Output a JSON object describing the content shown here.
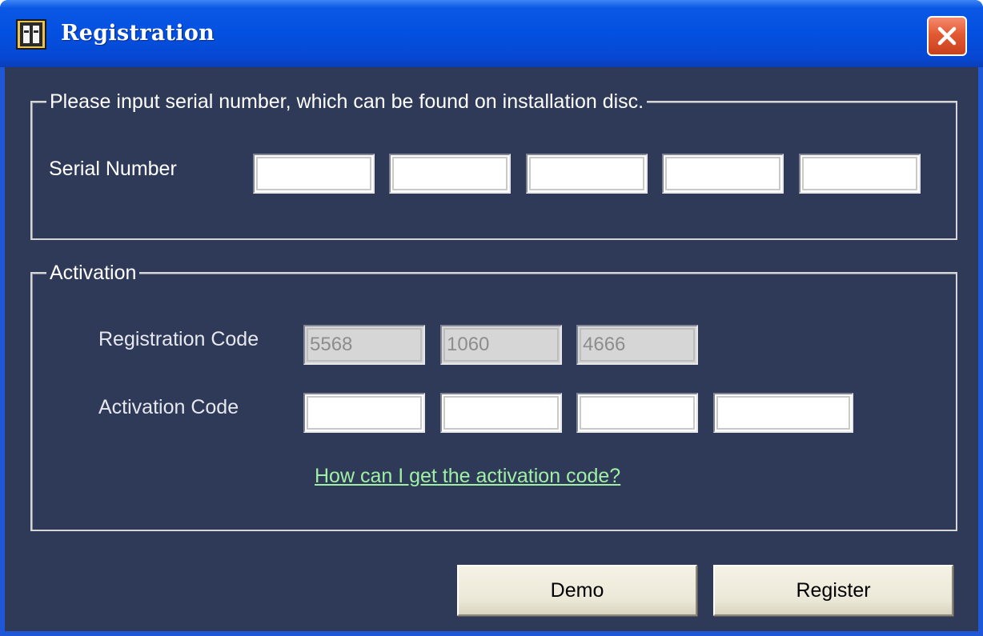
{
  "window": {
    "title": "Registration",
    "icon": "keyhole-icon",
    "close_icon": "close-icon",
    "accent_color": "#0450e0",
    "background_color": "#2f3a58"
  },
  "serial_group": {
    "legend": "Please input serial number, which can be found on installation disc.",
    "label": "Serial Number",
    "fields": [
      "",
      "",
      "",
      "",
      ""
    ]
  },
  "activation_group": {
    "legend": "Activation",
    "registration_label": "Registration Code",
    "registration_values": [
      "5568",
      "1060",
      "4666"
    ],
    "activation_label": "Activation Code",
    "activation_fields": [
      "",
      "",
      "",
      ""
    ],
    "help_link": "How can I get the activation code?",
    "link_color": "#9ff0a4"
  },
  "buttons": {
    "demo": "Demo",
    "register": "Register"
  }
}
